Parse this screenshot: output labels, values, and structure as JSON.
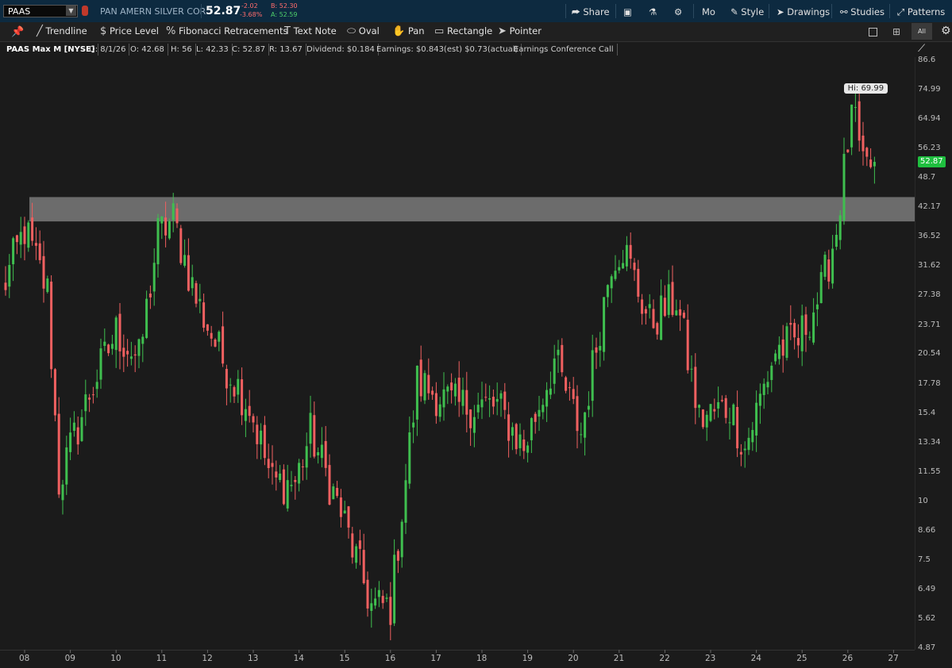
{
  "header": {
    "symbol": "PAAS",
    "company": "PAN AMERN SILVER COR",
    "last": "52.87",
    "change": "-2.02",
    "change_pct": "-3.68%",
    "bid": "B: 52.30",
    "ask": "A: 52.59",
    "share": "Share",
    "timeframe": "Mo",
    "style": "Style",
    "drawings": "Drawings",
    "studies": "Studies",
    "patterns": "Patterns"
  },
  "drawing_tools": [
    "Trendline",
    "Price Level",
    "Fibonacci Retracements",
    "Text Note",
    "Oval",
    "Pan",
    "Rectangle",
    "Pointer"
  ],
  "layout_all": "All",
  "info": {
    "title": "PAAS Max M [NYSE]",
    "date": "D: 8/1/26",
    "open": "O: 42.68",
    "high": "H: 56",
    "low": "L: 42.33",
    "close": "C: 52.87",
    "range": "R: 13.67",
    "dividend": "Dividend: $0.184",
    "earnings": "Earnings: $0.843(est) $0.73(actual)",
    "conference": "Earnings Conference Call"
  },
  "colors": {
    "up": "#3fbf4f",
    "down": "#f06060",
    "band": "#7a7a7a",
    "last_badge": "#1fbf3f"
  },
  "chart_data": {
    "type": "candlestick",
    "y_scale": "log",
    "y_ticks": [
      "86.6",
      "74.99",
      "64.94",
      "56.23",
      "48.7",
      "42.17",
      "36.52",
      "31.62",
      "27.38",
      "23.71",
      "20.54",
      "17.78",
      "15.4",
      "13.34",
      "11.55",
      "10",
      "8.66",
      "7.5",
      "6.49",
      "5.62",
      "4.87"
    ],
    "x_ticks": [
      "08",
      "09",
      "10",
      "11",
      "12",
      "13",
      "14",
      "15",
      "16",
      "17",
      "18",
      "19",
      "20",
      "21",
      "22",
      "23",
      "24",
      "25",
      "26",
      "27"
    ],
    "last_price": "52.87",
    "high_label": "Hi: 69.99",
    "resistance_zone": [
      39.5,
      44.5
    ],
    "close_path": [
      [
        "2007-07",
        28
      ],
      [
        "2008-01",
        38
      ],
      [
        "2008-07",
        28
      ],
      [
        "2008-10",
        11
      ],
      [
        "2009-06",
        17
      ],
      [
        "2010-01",
        23
      ],
      [
        "2010-07",
        20
      ],
      [
        "2010-12",
        37
      ],
      [
        "2011-04",
        40
      ],
      [
        "2011-10",
        27
      ],
      [
        "2012-05",
        20
      ],
      [
        "2012-12",
        16
      ],
      [
        "2013-06",
        11
      ],
      [
        "2013-12",
        11
      ],
      [
        "2014-04",
        14
      ],
      [
        "2014-12",
        9.5
      ],
      [
        "2015-08",
        6
      ],
      [
        "2016-01",
        6
      ],
      [
        "2016-08",
        18
      ],
      [
        "2017-06",
        16
      ],
      [
        "2018-05",
        16
      ],
      [
        "2018-12",
        13
      ],
      [
        "2019-08",
        20
      ],
      [
        "2020-03",
        14
      ],
      [
        "2020-11",
        33
      ],
      [
        "2021-02",
        35
      ],
      [
        "2021-09",
        24
      ],
      [
        "2022-04",
        27
      ],
      [
        "2022-10",
        15
      ],
      [
        "2023-06",
        16
      ],
      [
        "2023-10",
        13
      ],
      [
        "2024-06",
        21
      ],
      [
        "2024-12",
        22
      ],
      [
        "2025-06",
        28
      ],
      [
        "2025-10",
        38
      ],
      [
        "2026-01",
        58
      ],
      [
        "2026-02",
        69.99
      ],
      [
        "2026-05",
        50
      ],
      [
        "2026-08",
        52.87
      ]
    ]
  }
}
